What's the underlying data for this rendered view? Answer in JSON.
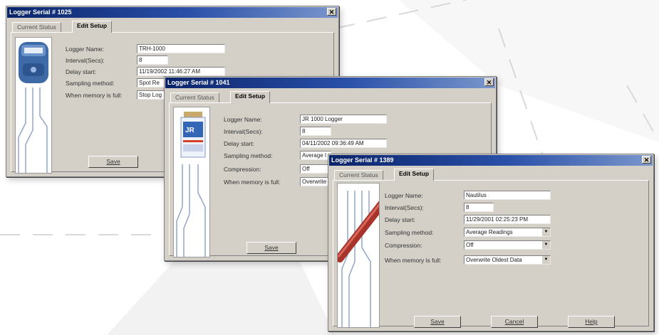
{
  "windows": [
    {
      "title": "Logger Serial # 1025",
      "tabs": [
        "Current Status",
        "Edit Setup"
      ],
      "labels": [
        "Logger Name:",
        "Interval(Secs):",
        "Delay start:",
        "Sampling method:",
        "When memory is full:"
      ],
      "fields": [
        "TRH-1000",
        "8",
        "11/19/2002 11:46:27 AM",
        "Spot Re",
        "Stop Log"
      ],
      "buttons": [
        "Save"
      ]
    },
    {
      "title": "Logger Serial # 1041",
      "tabs": [
        "Current Status",
        "Edit Setup"
      ],
      "labels": [
        "Logger Name:",
        "Interval(Secs):",
        "Delay start:",
        "Sampling method:",
        "Compression:",
        "When memory is full:"
      ],
      "fields": [
        "JR 1000 Logger",
        "8",
        "04/11/2002 09:36:49 AM",
        "Average I",
        "Off",
        "Overwrite"
      ],
      "buttons": [
        "Save"
      ]
    },
    {
      "title": "Logger Serial # 1389",
      "tabs": [
        "Current Status",
        "Edit Setup"
      ],
      "labels": [
        "Logger Name:",
        "Interval(Secs):",
        "Delay start:",
        "Sampling method:",
        "Compression:",
        "When memory is full:"
      ],
      "fields": [
        "Nautilus",
        "8",
        "11/29/2001 02:25:23 PM",
        "Average Readings",
        "Off",
        "Overwrite Oldest Data"
      ],
      "buttons": [
        "Save",
        "Cancel",
        "Help"
      ]
    }
  ],
  "icons": [
    "close-icon",
    "dropdown-arrow-icon",
    "logger-device-image"
  ],
  "colors": {
    "titlebar": "#0a246a",
    "dialog": "#d4d0c8",
    "field": "#ffffff"
  }
}
